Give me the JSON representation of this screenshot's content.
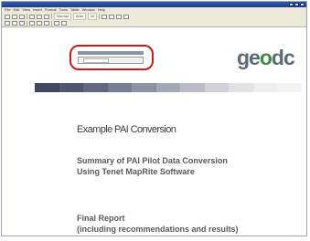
{
  "window": {
    "title": ""
  },
  "menubar": {
    "items": [
      "File",
      "Edit",
      "View",
      "Insert",
      "Format",
      "Tools",
      "Table",
      "Window",
      "Help"
    ]
  },
  "toolbar": {
    "dropdown_labels": [
      "Normal",
      "Arial",
      "10"
    ]
  },
  "highlight": {
    "row_label": ""
  },
  "logo": {
    "text_a": "ge",
    "text_o": "o",
    "text_b": "dc",
    "tagline": ""
  },
  "band_colors": [
    "#3f4660",
    "#4f5670",
    "#62697f",
    "#777d90",
    "#8d92a2",
    "#a4a8b5",
    "#babdc7",
    "#cfd1d8",
    "#e0e2e6",
    "#eceef0",
    "#f3f4f5"
  ],
  "document": {
    "title": "Example PAI Conversion",
    "subtitle_line1": "Summary of PAI Pilot Data Conversion",
    "subtitle_line2": "Using Tenet MapRite Software",
    "report_line1": "Final Report",
    "report_line2": "(including recommendations and results)"
  }
}
